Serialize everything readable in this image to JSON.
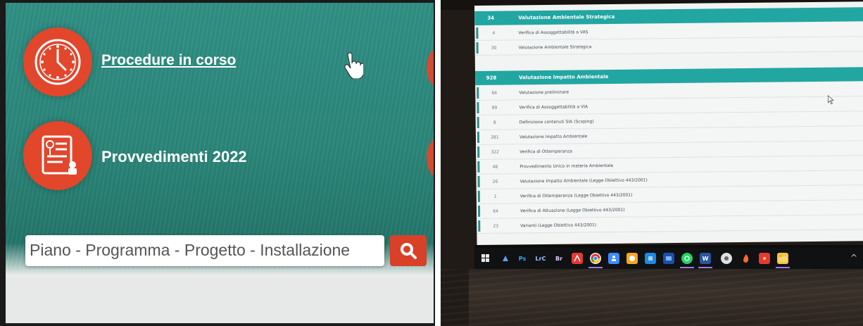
{
  "left": {
    "procedure_link": "Procedure in corso",
    "provvedimenti_title": "Provvedimenti 2022",
    "search_text": "Piano - Programma - Progetto - Installazione"
  },
  "right": {
    "sections": [
      {
        "header": {
          "count": "34",
          "label": "Valutazione Ambientale Strategica"
        },
        "rows": [
          {
            "count": "4",
            "label": "Verifica di Assoggettabilità a VAS"
          },
          {
            "count": "30",
            "label": "Valutazione Ambientale Strategica"
          }
        ]
      },
      {
        "header": {
          "count": "928",
          "label": "Valutazione Impatto Ambientale"
        },
        "rows": [
          {
            "count": "66",
            "label": "Valutazione preliminare"
          },
          {
            "count": "89",
            "label": "Verifica di Assoggettabilità a VIA"
          },
          {
            "count": "8",
            "label": "Definizione contenuti SIA (Scoping)"
          },
          {
            "count": "281",
            "label": "Valutazione Impatto Ambientale"
          },
          {
            "count": "322",
            "label": "Verifica di Ottemperanza"
          },
          {
            "count": "48",
            "label": "Provvedimento Unico in materia Ambientale"
          },
          {
            "count": "26",
            "label": "Valutazione Impatto Ambientale (Legge Obiettivo 443/2001)"
          },
          {
            "count": "1",
            "label": "Verifica di Ottemperanza (Legge Obiettivo 443/2001)"
          },
          {
            "count": "64",
            "label": "Verifica di Attuazione (Legge Obiettivo 443/2001)"
          },
          {
            "count": "23",
            "label": "Varianti (Legge Obiettivo 443/2001)"
          }
        ]
      }
    ],
    "taskbar": {
      "ps": "Ps",
      "lrc": "LrC",
      "br": "Br",
      "word": "W"
    }
  },
  "colors": {
    "teal": "#2a8478",
    "red": "#e2462b",
    "header_teal": "#22a6a2"
  }
}
